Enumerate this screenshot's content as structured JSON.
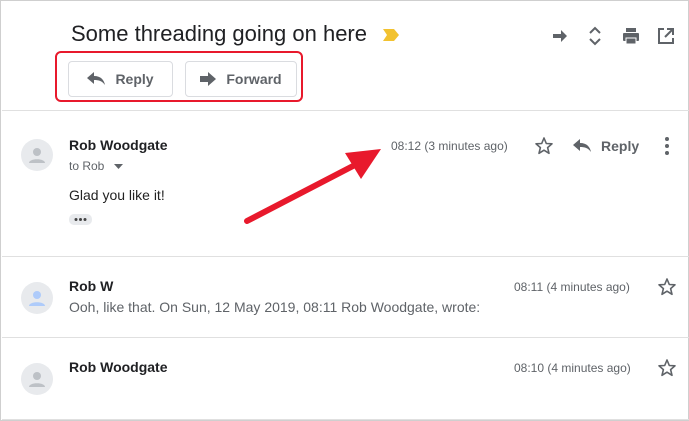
{
  "thread": {
    "subject": "Some threading going on here",
    "label_color": "#f2c230"
  },
  "toolbar": {
    "icons": [
      "move-to-icon",
      "expand-all-icon",
      "print-icon",
      "open-in-new-window-icon"
    ]
  },
  "actions": {
    "reply_label": "Reply",
    "forward_label": "Forward"
  },
  "annotation": {
    "highlight_color": "#e8192c"
  },
  "messages": [
    {
      "sender": "Rob Woodgate",
      "to": "to Rob",
      "timestamp": "08:12 (3 minutes ago)",
      "body": "Glad you like it!",
      "reply_label": "Reply"
    },
    {
      "sender": "Rob W",
      "timestamp": "08:11 (4 minutes ago)",
      "snippet": "Ooh, like that. On Sun, 12 May 2019, 08:11 Rob Woodgate, wrote:"
    },
    {
      "sender": "Rob Woodgate",
      "timestamp": "08:10 (4 minutes ago)"
    }
  ]
}
